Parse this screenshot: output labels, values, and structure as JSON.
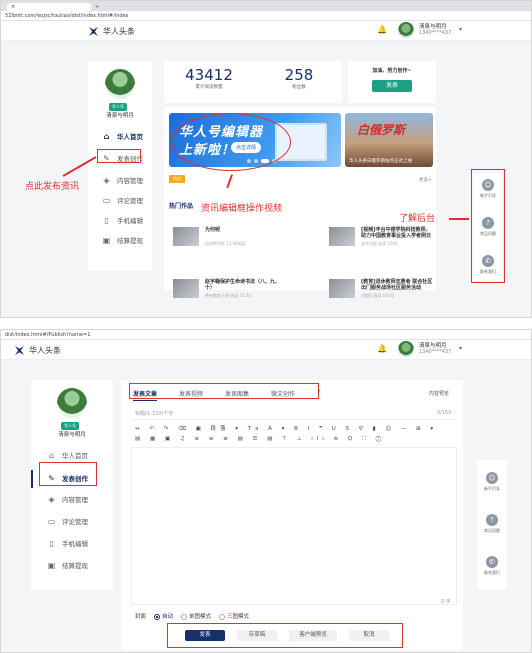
{
  "shot1": {
    "browser": {
      "close_glyph": "×",
      "new_tab_glyph": "+",
      "url": "52lbntt.com/wzjsc/toutiao/dist/index.html#/index"
    },
    "header": {
      "app_title": "华人头条",
      "user_name": "清泉与明月",
      "user_phone": "1340****437",
      "caret": "▾"
    },
    "profile": {
      "badge": "华人号",
      "name": "清泉与明月"
    },
    "nav": [
      {
        "label": "华人首页",
        "icon": "home-icon"
      },
      {
        "label": "发表创作",
        "icon": "pen-icon"
      },
      {
        "label": "内容管理",
        "icon": "layers-icon"
      },
      {
        "label": "评论管理",
        "icon": "comment-icon"
      },
      {
        "label": "手机编辑",
        "icon": "phone-icon"
      },
      {
        "label": "结算提现",
        "icon": "wallet-icon"
      }
    ],
    "stats": [
      {
        "value": "43412",
        "label": "累计阅读数量"
      },
      {
        "value": "258",
        "label": "粉丝数"
      }
    ],
    "publish_card": {
      "slogan": "加油、努力创作~",
      "button": "发表"
    },
    "banner_main": {
      "line1": "华人号编辑器",
      "line2": "上新啦！",
      "cta": "点击详情"
    },
    "banner_side": {
      "title": "白俄罗斯",
      "caption": "华人头条白俄罗斯站点正式上线"
    },
    "chip": "热点",
    "more": "更多>",
    "section_title": "热门作品",
    "articles": [
      {
        "title": "为何呢",
        "meta": "迈阿密华侨    13:49阅读"
      },
      {
        "title": "[视频]丰台中德学院科技教师，助力中国教育事业投入学者例日",
        "meta": "北京日报    阅读 2341"
      },
      {
        "title": "赵宇翰保护生命诗书法（八、九、十）",
        "meta": "德州教育十期  阅读 21:35"
      },
      {
        "title": "[教育]退休教师志愿者 联合社区出门服务战场社区服务活动",
        "meta": "(视频)    阅读 19:01"
      }
    ],
    "rail": [
      {
        "label": "新手引导",
        "icon": "person-icon"
      },
      {
        "label": "常见问题",
        "icon": "question-icon"
      },
      {
        "label": "联系我们",
        "icon": "phone-call-icon"
      }
    ],
    "annotations": {
      "left": "点此发布资讯",
      "middle": "资讯编辑框操作视频",
      "right": "了解后台"
    }
  },
  "shot2": {
    "browser": {
      "url": "dist/index.html#/Publish?name=1"
    },
    "header": {
      "app_title": "华人头条",
      "user_name": "清泉与明月",
      "user_phone": "1340****437",
      "caret": "▾"
    },
    "profile": {
      "badge": "华人号",
      "name": "清泉与明月"
    },
    "nav": [
      {
        "label": "华人首页",
        "icon": "home-icon"
      },
      {
        "label": "发表创作",
        "icon": "pen-icon"
      },
      {
        "label": "内容管理",
        "icon": "layers-icon"
      },
      {
        "label": "评论管理",
        "icon": "comment-icon"
      },
      {
        "label": "手机编辑",
        "icon": "phone-icon"
      },
      {
        "label": "结算提现",
        "icon": "wallet-icon"
      }
    ],
    "tabs": [
      "发表文章",
      "发表视频",
      "发表图集",
      "微文创作"
    ],
    "help_glyph": "?",
    "preview": "内容预览",
    "title_placeholder": "标题(1-150)个字",
    "title_counter": "0/150",
    "toolbar_row1": "↔ ↶ ↷ ⌫ ▣ 段落 ▾ Tx A ▾ B I ❞ U S ⚲ ▮ ☺ — ⊞ ▾",
    "toolbar_row2": "▤ ▦ ▣ ♫ ≡ ≡ ≡ ▤ ☰ ▤ ⊤ ⊥ ılı ≋ Q ⛶ ⓘ",
    "editor_footer": "0 字",
    "cover": {
      "label": "封面",
      "options": [
        "自动",
        "单图模式",
        "三图模式"
      ],
      "selected": 0
    },
    "buttons": [
      "发表",
      "存草稿",
      "客户端预览",
      "取消"
    ],
    "rail": [
      {
        "label": "新手引导",
        "icon": "person-icon"
      },
      {
        "label": "常见问题",
        "icon": "question-icon"
      },
      {
        "label": "联系我们",
        "icon": "phone-call-icon"
      }
    ]
  },
  "colors": {
    "brand": "#15306b",
    "accent": "#1aa184",
    "annotation": "#e03030"
  }
}
